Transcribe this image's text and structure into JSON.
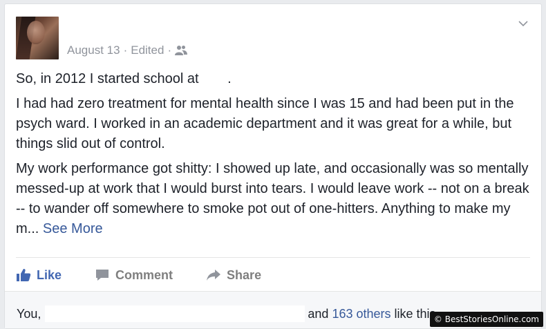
{
  "post": {
    "date": "August 13",
    "edited": "Edited",
    "separator": "·",
    "paragraphs": [
      {
        "text": "So, in 2012 I started school at",
        "after": "."
      },
      {
        "text": "I had had zero treatment for mental health since I was 15 and had been put in the psych ward. I worked in an academic department and it was great for a while, but things slid out of control."
      },
      {
        "text": "My work performance got shitty: I showed up late, and occasionally was so mentally messed-up at work that I would burst into tears. I would leave work -- not on a break -- to wander off somewhere to smoke pot out of one-hitters. Anything to make my m...",
        "link": "See More"
      }
    ]
  },
  "actions": {
    "like": "Like",
    "comment": "Comment",
    "share": "Share"
  },
  "reactions": {
    "prefix": "You,",
    "and": "and",
    "count": "163 others",
    "suffix": "like this."
  },
  "watermark": "© BestStoriesOnline.com",
  "colors": {
    "link": "#365899",
    "like": "#4267b2",
    "meta": "#90949c",
    "text": "#1d2129"
  },
  "icons": {
    "audience": "friends-icon",
    "menu": "chevron-down-icon",
    "like": "thumbs-up-icon",
    "comment": "comment-bubble-icon",
    "share": "share-arrow-icon"
  }
}
